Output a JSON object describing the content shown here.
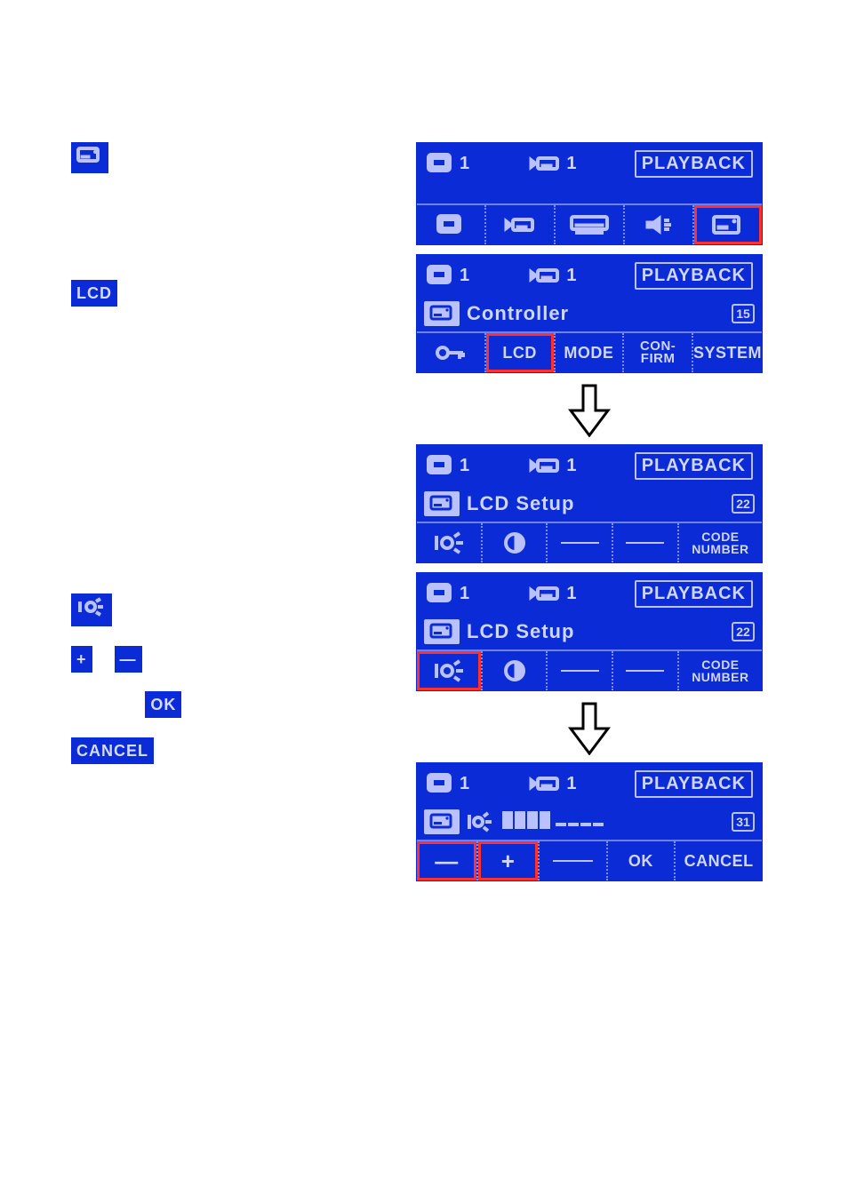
{
  "common": {
    "playback": "PLAYBACK",
    "monitor_num": "1",
    "tape_num": "1"
  },
  "chips": {
    "lcd": "LCD",
    "plus": "+",
    "minus": "—",
    "ok": "OK",
    "cancel": "CANCEL"
  },
  "screen1": {
    "tabs": [
      "monitor",
      "camera",
      "deck",
      "speaker",
      "controller"
    ]
  },
  "screen2": {
    "title": "Controller",
    "badge": "15",
    "tabs_text": {
      "lcd": "LCD",
      "mode": "MODE",
      "confirm": "CON-\nFIRM",
      "system": "SYSTEM"
    }
  },
  "screen3": {
    "title": "LCD Setup",
    "badge": "22",
    "code_number": "CODE\nNUMBER"
  },
  "screen4": {
    "title": "LCD Setup",
    "badge": "22",
    "code_number": "CODE\nNUMBER"
  },
  "screen5": {
    "badge": "31",
    "minus": "—",
    "plus": "+",
    "ok": "OK",
    "cancel": "CANCEL"
  }
}
